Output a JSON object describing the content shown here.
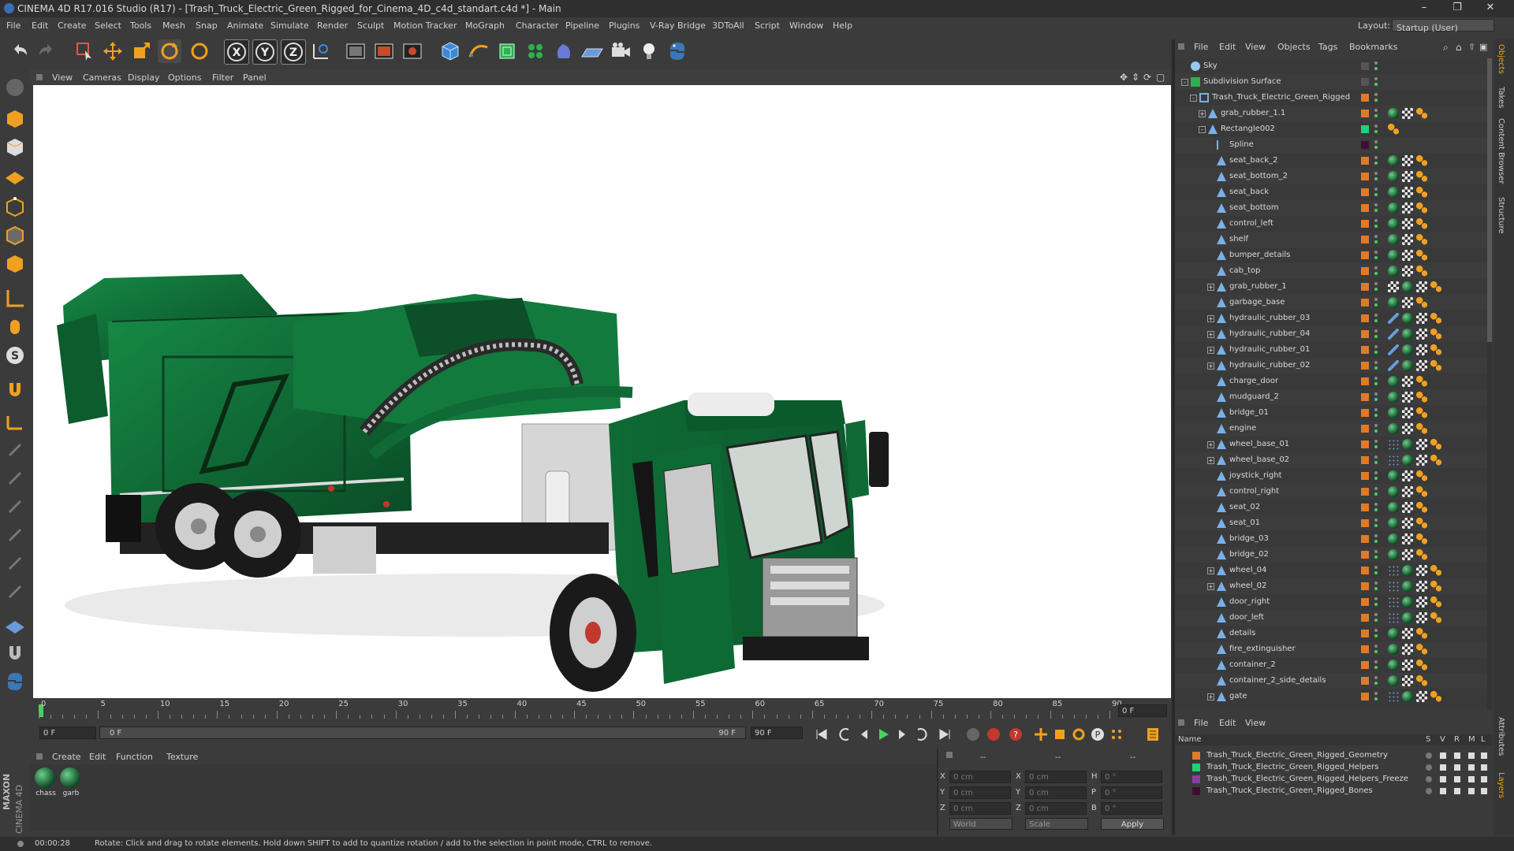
{
  "window": {
    "title": "CINEMA 4D R17.016 Studio (R17) - [Trash_Truck_Electric_Green_Rigged_for_Cinema_4D_c4d_standart.c4d *] - Main",
    "minimize": "–",
    "restore": "❐",
    "close": "✕"
  },
  "menubar": {
    "items": [
      "File",
      "Edit",
      "Create",
      "Select",
      "Tools",
      "Mesh",
      "Snap",
      "Animate",
      "Simulate",
      "Render",
      "Sculpt",
      "Motion Tracker",
      "MoGraph",
      "Character",
      "Pipeline",
      "Plugins",
      "V-Ray Bridge",
      "3DToAll",
      "Script",
      "Window",
      "Help"
    ],
    "layout_label": "Layout:",
    "layout_value": "Startup (User)"
  },
  "viewport": {
    "menu": [
      "View",
      "Cameras",
      "Display",
      "Options",
      "Filter",
      "Panel"
    ]
  },
  "timeline": {
    "ticks": [
      "0",
      "5",
      "10",
      "15",
      "20",
      "25",
      "30",
      "35",
      "40",
      "45",
      "50",
      "55",
      "60",
      "65",
      "70",
      "75",
      "80",
      "85",
      "90"
    ],
    "end_field": "0 F"
  },
  "transport": {
    "start_field": "0 F",
    "range_start": "0 F",
    "range_end": "90 F",
    "end_field": "90 F"
  },
  "material_manager": {
    "menu": [
      "Create",
      "Edit",
      "Function",
      "Texture"
    ],
    "materials": [
      {
        "name": "chass"
      },
      {
        "name": "garb"
      }
    ]
  },
  "coordinates": {
    "header": [
      "--",
      "--",
      "--"
    ],
    "rows": [
      {
        "axis": "X",
        "pos": "0 cm",
        "size_axis": "X",
        "size": "0 cm",
        "rot_axis": "H",
        "rot": "0 °"
      },
      {
        "axis": "Y",
        "pos": "0 cm",
        "size_axis": "Y",
        "size": "0 cm",
        "rot_axis": "P",
        "rot": "0 °"
      },
      {
        "axis": "Z",
        "pos": "0 cm",
        "size_axis": "Z",
        "size": "0 cm",
        "rot_axis": "B",
        "rot": "0 °"
      }
    ],
    "mode": "World",
    "size_mode": "Scale",
    "apply": "Apply"
  },
  "object_manager": {
    "menu": [
      "File",
      "Edit",
      "View",
      "Objects",
      "Tags",
      "Bookmarks"
    ],
    "objects": [
      {
        "name": "Sky",
        "depth": 0,
        "expand": "",
        "icon": "sky",
        "layer": "",
        "tags": []
      },
      {
        "name": "Subdivision Surface",
        "depth": 0,
        "expand": "-",
        "icon": "subdiv",
        "layer": "",
        "tags": []
      },
      {
        "name": "Trash_Truck_Electric_Green_Rigged",
        "depth": 1,
        "expand": "-",
        "icon": "null",
        "layer": "#e07a2a",
        "tags": []
      },
      {
        "name": "grab_rubber_1.1",
        "depth": 2,
        "expand": "+",
        "icon": "poly",
        "layer": "#e07a2a",
        "tags": [
          "mat",
          "tex",
          "orange"
        ]
      },
      {
        "name": "Rectangle002",
        "depth": 2,
        "expand": "-",
        "icon": "poly",
        "layer": "#1fd07a",
        "tags": [
          "orange"
        ]
      },
      {
        "name": "Spline",
        "depth": 3,
        "expand": "",
        "icon": "spline",
        "layer": "#3a1030",
        "tags": []
      },
      {
        "name": "seat_back_2",
        "depth": 3,
        "expand": "",
        "icon": "poly",
        "layer": "#e07a2a",
        "tags": [
          "mat",
          "tex",
          "orange"
        ]
      },
      {
        "name": "seat_bottom_2",
        "depth": 3,
        "expand": "",
        "icon": "poly",
        "layer": "#e07a2a",
        "tags": [
          "mat",
          "tex",
          "orange"
        ]
      },
      {
        "name": "seat_back",
        "depth": 3,
        "expand": "",
        "icon": "poly",
        "layer": "#e07a2a",
        "tags": [
          "mat",
          "tex",
          "orange"
        ]
      },
      {
        "name": "seat_bottom",
        "depth": 3,
        "expand": "",
        "icon": "poly",
        "layer": "#e07a2a",
        "tags": [
          "mat",
          "tex",
          "orange"
        ]
      },
      {
        "name": "control_left",
        "depth": 3,
        "expand": "",
        "icon": "poly",
        "layer": "#e07a2a",
        "tags": [
          "mat",
          "tex",
          "orange"
        ]
      },
      {
        "name": "shelf",
        "depth": 3,
        "expand": "",
        "icon": "poly",
        "layer": "#e07a2a",
        "tags": [
          "mat",
          "tex",
          "orange"
        ]
      },
      {
        "name": "bumper_details",
        "depth": 3,
        "expand": "",
        "icon": "poly",
        "layer": "#e07a2a",
        "tags": [
          "mat",
          "tex",
          "orange"
        ]
      },
      {
        "name": "cab_top",
        "depth": 3,
        "expand": "",
        "icon": "poly",
        "layer": "#e07a2a",
        "tags": [
          "mat",
          "tex",
          "orange"
        ]
      },
      {
        "name": "grab_rubber_1",
        "depth": 3,
        "expand": "+",
        "icon": "poly",
        "layer": "#e07a2a",
        "tags": [
          "tex",
          "mat",
          "tex",
          "orange"
        ]
      },
      {
        "name": "garbage_base",
        "depth": 3,
        "expand": "",
        "icon": "poly",
        "layer": "#e07a2a",
        "tags": [
          "mat",
          "tex",
          "orange"
        ]
      },
      {
        "name": "hydraulic_rubber_03",
        "depth": 3,
        "expand": "+",
        "icon": "poly",
        "layer": "#e07a2a",
        "tags": [
          "ik",
          "mat",
          "tex",
          "orange"
        ]
      },
      {
        "name": "hydraulic_rubber_04",
        "depth": 3,
        "expand": "+",
        "icon": "poly",
        "layer": "#e07a2a",
        "tags": [
          "ik",
          "mat",
          "tex",
          "orange"
        ]
      },
      {
        "name": "hydraulic_rubber_01",
        "depth": 3,
        "expand": "+",
        "icon": "poly",
        "layer": "#e07a2a",
        "tags": [
          "ik",
          "mat",
          "tex",
          "orange"
        ]
      },
      {
        "name": "hydraulic_rubber_02",
        "depth": 3,
        "expand": "+",
        "icon": "poly",
        "layer": "#e07a2a",
        "tags": [
          "ik",
          "mat",
          "tex",
          "orange"
        ]
      },
      {
        "name": "charge_door",
        "depth": 3,
        "expand": "",
        "icon": "poly",
        "layer": "#e07a2a",
        "tags": [
          "mat",
          "tex",
          "orange"
        ]
      },
      {
        "name": "mudguard_2",
        "depth": 3,
        "expand": "",
        "icon": "poly",
        "layer": "#e07a2a",
        "tags": [
          "mat",
          "tex",
          "orange"
        ]
      },
      {
        "name": "bridge_01",
        "depth": 3,
        "expand": "",
        "icon": "poly",
        "layer": "#e07a2a",
        "tags": [
          "mat",
          "tex",
          "orange"
        ]
      },
      {
        "name": "engine",
        "depth": 3,
        "expand": "",
        "icon": "poly",
        "layer": "#e07a2a",
        "tags": [
          "mat",
          "tex",
          "orange"
        ]
      },
      {
        "name": "wheel_base_01",
        "depth": 3,
        "expand": "+",
        "icon": "poly",
        "layer": "#e07a2a",
        "tags": [
          "dots",
          "mat",
          "tex",
          "orange"
        ]
      },
      {
        "name": "wheel_base_02",
        "depth": 3,
        "expand": "+",
        "icon": "poly",
        "layer": "#e07a2a",
        "tags": [
          "dots",
          "mat",
          "tex",
          "orange"
        ]
      },
      {
        "name": "joystick_right",
        "depth": 3,
        "expand": "",
        "icon": "poly",
        "layer": "#e07a2a",
        "tags": [
          "mat",
          "tex",
          "orange"
        ]
      },
      {
        "name": "control_right",
        "depth": 3,
        "expand": "",
        "icon": "poly",
        "layer": "#e07a2a",
        "tags": [
          "mat",
          "tex",
          "orange"
        ]
      },
      {
        "name": "seat_02",
        "depth": 3,
        "expand": "",
        "icon": "poly",
        "layer": "#e07a2a",
        "tags": [
          "mat",
          "tex",
          "orange"
        ]
      },
      {
        "name": "seat_01",
        "depth": 3,
        "expand": "",
        "icon": "poly",
        "layer": "#e07a2a",
        "tags": [
          "mat",
          "tex",
          "orange"
        ]
      },
      {
        "name": "bridge_03",
        "depth": 3,
        "expand": "",
        "icon": "poly",
        "layer": "#e07a2a",
        "tags": [
          "mat",
          "tex",
          "orange"
        ]
      },
      {
        "name": "bridge_02",
        "depth": 3,
        "expand": "",
        "icon": "poly",
        "layer": "#e07a2a",
        "tags": [
          "mat",
          "tex",
          "orange"
        ]
      },
      {
        "name": "wheel_04",
        "depth": 3,
        "expand": "+",
        "icon": "poly",
        "layer": "#e07a2a",
        "tags": [
          "dots",
          "mat",
          "tex",
          "orange"
        ]
      },
      {
        "name": "wheel_02",
        "depth": 3,
        "expand": "+",
        "icon": "poly",
        "layer": "#e07a2a",
        "tags": [
          "dots",
          "mat",
          "tex",
          "orange"
        ]
      },
      {
        "name": "door_right",
        "depth": 3,
        "expand": "",
        "icon": "poly",
        "layer": "#e07a2a",
        "tags": [
          "dots",
          "mat",
          "tex",
          "orange"
        ]
      },
      {
        "name": "door_left",
        "depth": 3,
        "expand": "",
        "icon": "poly",
        "layer": "#e07a2a",
        "tags": [
          "dots",
          "mat",
          "tex",
          "orange"
        ]
      },
      {
        "name": "details",
        "depth": 3,
        "expand": "",
        "icon": "poly",
        "layer": "#e07a2a",
        "tags": [
          "mat",
          "tex",
          "orange"
        ]
      },
      {
        "name": "fire_extinguisher",
        "depth": 3,
        "expand": "",
        "icon": "poly",
        "layer": "#e07a2a",
        "tags": [
          "mat",
          "tex",
          "orange"
        ]
      },
      {
        "name": "container_2",
        "depth": 3,
        "expand": "",
        "icon": "poly",
        "layer": "#e07a2a",
        "tags": [
          "mat",
          "tex",
          "orange"
        ]
      },
      {
        "name": "container_2_side_details",
        "depth": 3,
        "expand": "",
        "icon": "poly",
        "layer": "#e07a2a",
        "tags": [
          "mat",
          "tex",
          "orange"
        ]
      },
      {
        "name": "gate",
        "depth": 3,
        "expand": "+",
        "icon": "poly",
        "layer": "#e07a2a",
        "tags": [
          "dots",
          "mat",
          "tex",
          "orange"
        ]
      }
    ]
  },
  "right_tabs": [
    "Objects",
    "Takes",
    "Content Browser",
    "Structure",
    "Attributes",
    "Layers"
  ],
  "layer_manager": {
    "menu": [
      "File",
      "Edit",
      "View"
    ],
    "columns": {
      "name": "Name",
      "s": "S",
      "v": "V",
      "r": "R",
      "m": "M",
      "l": "L"
    },
    "layers": [
      {
        "name": "Trash_Truck_Electric_Green_Rigged_Geometry",
        "color": "#e07a2a"
      },
      {
        "name": "Trash_Truck_Electric_Green_Rigged_Helpers",
        "color": "#1fd07a"
      },
      {
        "name": "Trash_Truck_Electric_Green_Rigged_Helpers_Freeze",
        "color": "#8a3fa0"
      },
      {
        "name": "Trash_Truck_Electric_Green_Rigged_Bones",
        "color": "#3a1030"
      }
    ]
  },
  "statusbar": {
    "time": "00:00:28",
    "message": "Rotate: Click and drag to rotate elements. Hold down SHIFT to add to quantize rotation / add to the selection in point mode, CTRL to remove."
  },
  "brand": {
    "line1": "MAXON",
    "line2": "CINEMA 4D"
  },
  "colors": {
    "truck_green": "#0f6a35",
    "accent_blue": "#3a8ad8",
    "orange": "#e07a2a"
  }
}
